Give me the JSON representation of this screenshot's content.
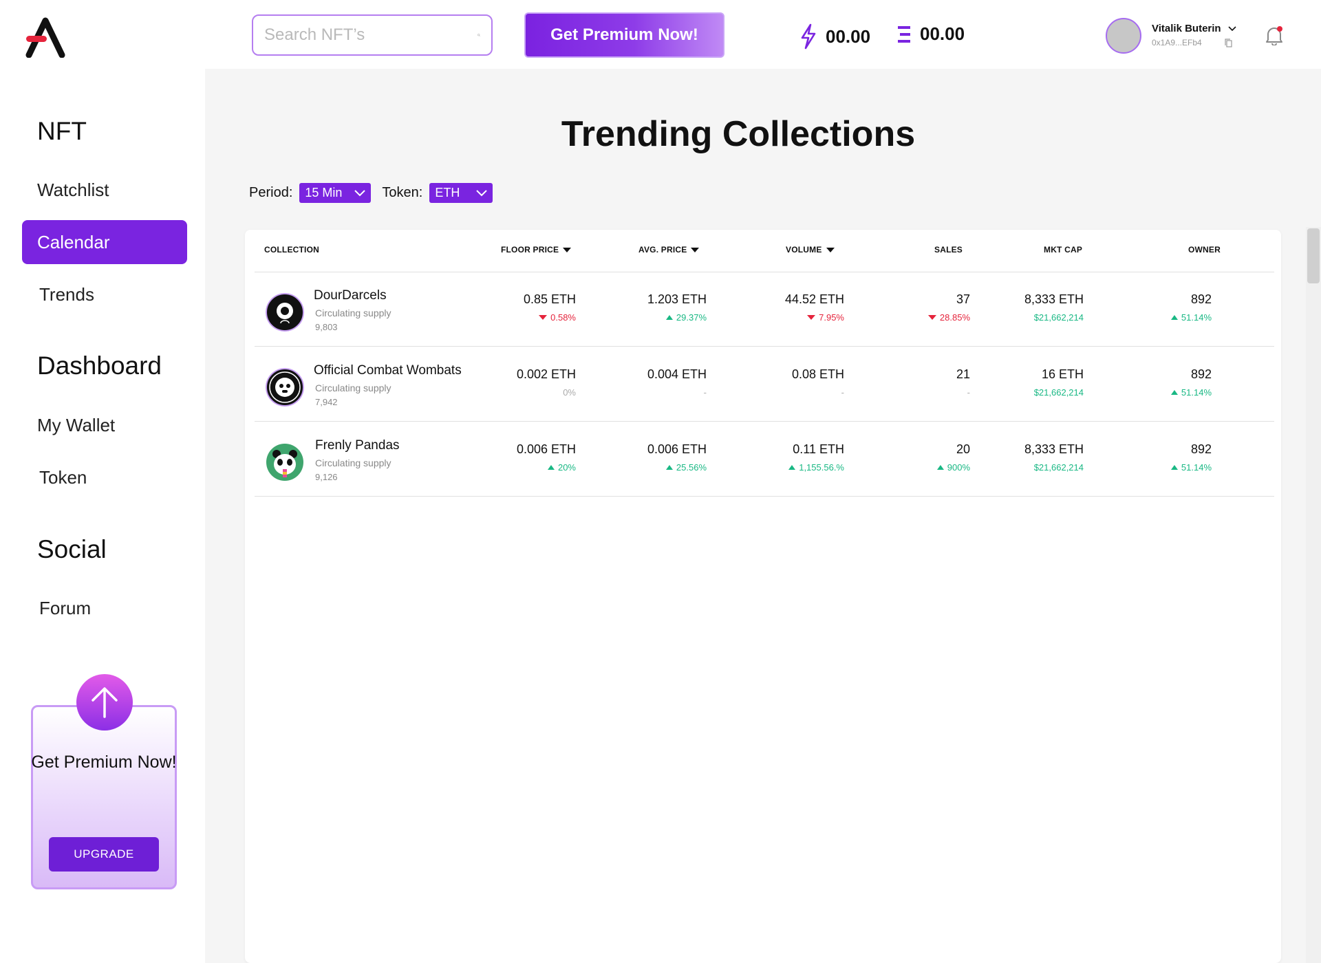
{
  "sidebar": {
    "sections": [
      {
        "title": "NFT",
        "items": [
          {
            "label": "Watchlist",
            "active": false
          },
          {
            "label": "Calendar",
            "active": true
          },
          {
            "label": "Trends",
            "active": false
          }
        ]
      },
      {
        "title": "Dashboard",
        "items": [
          {
            "label": "My Wallet",
            "active": false
          },
          {
            "label": "Token",
            "active": false
          }
        ]
      },
      {
        "title": "Social",
        "items": [
          {
            "label": "Forum",
            "active": false
          }
        ]
      }
    ],
    "premium_card": {
      "title": "Get Premium Now!",
      "button_label": "UPGRADE",
      "icon": "arrow-up-icon"
    }
  },
  "header": {
    "search_placeholder": "Search NFT’s",
    "premium_button": "Get Premium Now!",
    "energy_balance": "00.00",
    "eth_balance": "00.00",
    "user": {
      "name": "Vitalik Buterin",
      "address": "0x1A9...EFb4"
    }
  },
  "main": {
    "title": "Trending Collections",
    "period_label": "Period:",
    "period_value": "15 Min",
    "token_label": "Token:",
    "token_value": "ETH",
    "columns": [
      "COLLECTION",
      "FLOOR PRICE",
      "AVG. PRICE",
      "VOLUME",
      "SALES",
      "MKT CAP",
      "OWNER"
    ],
    "rows": [
      {
        "name": "DourDarcels",
        "sub": "Circulating supply",
        "supply": "9,803",
        "floor": "0.85 ETH",
        "floor_chg": "0.58%",
        "floor_dir": "down",
        "avg": "1.203 ETH",
        "avg_chg": "29.37%",
        "avg_dir": "up",
        "volume": "44.52 ETH",
        "volume_chg": "7.95%",
        "volume_dir": "down",
        "sales": "37",
        "sales_chg": "28.85%",
        "sales_dir": "down",
        "mktcap": "8,333 ETH",
        "mktcap_usd": "$21,662,214",
        "owner": "892",
        "owner_chg": "51.14%",
        "owner_dir": "up"
      },
      {
        "name": "Official Combat Wombats",
        "sub": "Circulating supply",
        "supply": "7,942",
        "floor": "0.002 ETH",
        "floor_chg": "0%",
        "floor_dir": "neutral",
        "avg": "0.004 ETH",
        "avg_chg": "-",
        "avg_dir": "neutral",
        "volume": "0.08 ETH",
        "volume_chg": "-",
        "volume_dir": "neutral",
        "sales": "21",
        "sales_chg": "-",
        "sales_dir": "neutral",
        "mktcap": "16 ETH",
        "mktcap_usd": "$21,662,214",
        "owner": "892",
        "owner_chg": "51.14%",
        "owner_dir": "up"
      },
      {
        "name": "Frenly Pandas",
        "sub": "Circulating supply",
        "supply": "9,126",
        "floor": "0.006 ETH",
        "floor_chg": "20%",
        "floor_dir": "up",
        "avg": "0.006 ETH",
        "avg_chg": "25.56%",
        "avg_dir": "up",
        "volume": "0.11 ETH",
        "volume_chg": "1,155.56.%",
        "volume_dir": "up",
        "sales": "20",
        "sales_chg": "900%",
        "sales_dir": "up",
        "mktcap": "8,333 ETH",
        "mktcap_usd": "$21,662,214",
        "owner": "892",
        "owner_chg": "51.14%",
        "owner_dir": "up"
      }
    ]
  },
  "colors": {
    "accent": "#7a24e0",
    "up": "#19b884",
    "down": "#e5243c"
  }
}
